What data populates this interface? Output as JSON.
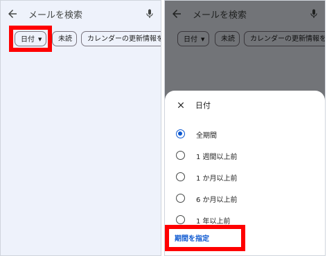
{
  "search": {
    "placeholder": "メールを検索"
  },
  "chips": {
    "date": "日付",
    "unread": "未読",
    "exclude_calendar": "カレンダーの更新情報を除外"
  },
  "sheet": {
    "title": "日付",
    "options": [
      {
        "label": "全期間",
        "selected": true
      },
      {
        "label": "1 週間以上前",
        "selected": false
      },
      {
        "label": "1 か月以上前",
        "selected": false
      },
      {
        "label": "6 か月以上前",
        "selected": false
      },
      {
        "label": "1 年以上前",
        "selected": false
      }
    ],
    "custom_range": "期間を指定"
  },
  "colors": {
    "highlight": "#ff0000",
    "accent": "#0b57d0",
    "background": "#eef2fb"
  },
  "icons": [
    "back-arrow-icon",
    "mic-icon",
    "caret-down-icon",
    "close-icon",
    "radio-icon"
  ]
}
